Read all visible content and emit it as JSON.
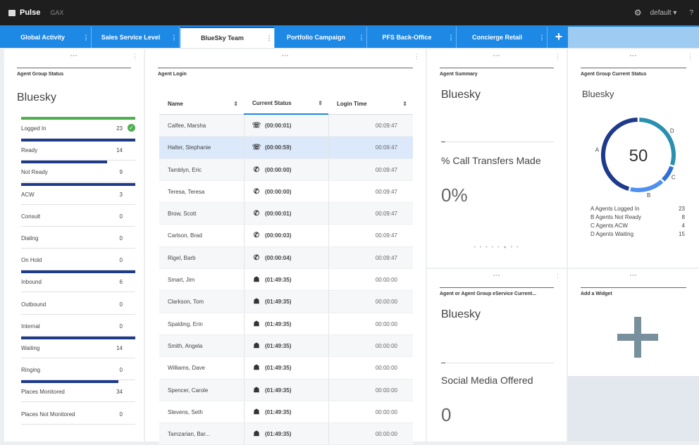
{
  "topbar": {
    "app_name": "Pulse",
    "secondary": "GAX",
    "gear": "⚙",
    "user": "default ▾",
    "help": "?"
  },
  "tabs": [
    {
      "label": "Global Activity"
    },
    {
      "label": "Sales Service Level"
    },
    {
      "label": "BlueSky Team"
    },
    {
      "label": "Portfolio Campaign"
    },
    {
      "label": "PFS Back-Office"
    },
    {
      "label": "Concierge Retail"
    }
  ],
  "tab_more": "⋮",
  "tab_add": "+",
  "agent_group_status": {
    "title": "Agent Group Status",
    "group": "Bluesky",
    "items": [
      {
        "label": "Logged In",
        "value": "23",
        "fill": 1.0,
        "color": "green"
      },
      {
        "label": "Ready",
        "value": "14",
        "fill": 1.0
      },
      {
        "label": "Not Ready",
        "value": "9",
        "fill": 0.75
      },
      {
        "label": "ACW",
        "value": "3",
        "fill": 1.0
      },
      {
        "label": "Consult",
        "value": "0",
        "fill": 0
      },
      {
        "label": "Dialing",
        "value": "0",
        "fill": 0
      },
      {
        "label": "On Hold",
        "value": "0",
        "fill": 0
      },
      {
        "label": "Inbound",
        "value": "6",
        "fill": 1.0
      },
      {
        "label": "Outbound",
        "value": "0",
        "fill": 0
      },
      {
        "label": "Internal",
        "value": "0",
        "fill": 0
      },
      {
        "label": "Waiting",
        "value": "14",
        "fill": 1.0
      },
      {
        "label": "Ringing",
        "value": "0",
        "fill": 0
      },
      {
        "label": "Places Monitored",
        "value": "34",
        "fill": 0.85
      },
      {
        "label": "Places Not Monitored",
        "value": "0",
        "fill": 0
      }
    ]
  },
  "agent_login": {
    "title": "Agent Login",
    "columns": [
      "Name",
      "Current Status",
      "Login Time"
    ],
    "sort_icon": "⇕",
    "rows": [
      {
        "name": "Calfee, Marsha",
        "icon": "phone-outgoing",
        "status": "(00:00:01)",
        "login": "00:09:47"
      },
      {
        "name": "Halter, Stephanie",
        "icon": "phone-outgoing",
        "status": "(00:00:59)",
        "login": "00:09:47"
      },
      {
        "name": "Tamblyn, Eric",
        "icon": "phone-incoming",
        "status": "(00:00:00)",
        "login": "00:09:47"
      },
      {
        "name": "Teresa, Teresa",
        "icon": "phone-incoming",
        "status": "(00:00:00)",
        "login": "00:09:47"
      },
      {
        "name": "Brow, Scott",
        "icon": "phone-incoming",
        "status": "(00:00:01)",
        "login": "00:09:47"
      },
      {
        "name": "Carlson, Brad",
        "icon": "phone-incoming",
        "status": "(00:00:03)",
        "login": "00:09:47"
      },
      {
        "name": "Rigel, Barb",
        "icon": "phone-incoming",
        "status": "(00:00:04)",
        "login": "00:09:47"
      },
      {
        "name": "Smart, Jim",
        "icon": "agent-away",
        "status": "(01:49:35)",
        "login": "00:00:00"
      },
      {
        "name": "Clarkson, Tom",
        "icon": "agent-away",
        "status": "(01:49:35)",
        "login": "00:00:00"
      },
      {
        "name": "Spalding, Erin",
        "icon": "agent-away",
        "status": "(01:49:35)",
        "login": "00:00:00"
      },
      {
        "name": "Smith, Angela",
        "icon": "agent-away",
        "status": "(01:49:35)",
        "login": "00:00:00"
      },
      {
        "name": "Williams, Dave",
        "icon": "agent-away",
        "status": "(01:49:35)",
        "login": "00:00:00"
      },
      {
        "name": "Spencer, Carole",
        "icon": "agent-away",
        "status": "(01:49:35)",
        "login": "00:00:00"
      },
      {
        "name": "Stevens, Seth",
        "icon": "agent-away",
        "status": "(01:49:35)",
        "login": "00:00:00"
      },
      {
        "name": "Tamzarian, Bar...",
        "icon": "agent-away",
        "status": "(01:49:35)",
        "login": "00:00:00"
      }
    ]
  },
  "agent_summary": {
    "title": "Agent Summary",
    "group": "Bluesky",
    "metric_label": "% Call Transfers Made",
    "metric_value": "0%",
    "pager": "• • • • • ● • •"
  },
  "agent_group_current_status": {
    "title": "Agent Group Current Status",
    "group": "Bluesky",
    "total": "50",
    "segments": [
      {
        "key": "A",
        "label": "A Agents Logged In",
        "value": 23,
        "color": "#1e3a8a"
      },
      {
        "key": "B",
        "label": "B Agents Not Ready",
        "value": 8,
        "color": "#4f8ff0"
      },
      {
        "key": "C",
        "label": "C Agents ACW",
        "value": 4,
        "color": "#2f6fd6"
      },
      {
        "key": "D",
        "label": "D Agents Waiting",
        "value": 15,
        "color": "#2a8fb0"
      }
    ]
  },
  "eservice": {
    "title": "Agent or Agent Group eService Current...",
    "group": "Bluesky",
    "metric_label": "Social Media Offered",
    "metric_value": "0"
  },
  "add_widget": {
    "title": "Add a Widget"
  }
}
